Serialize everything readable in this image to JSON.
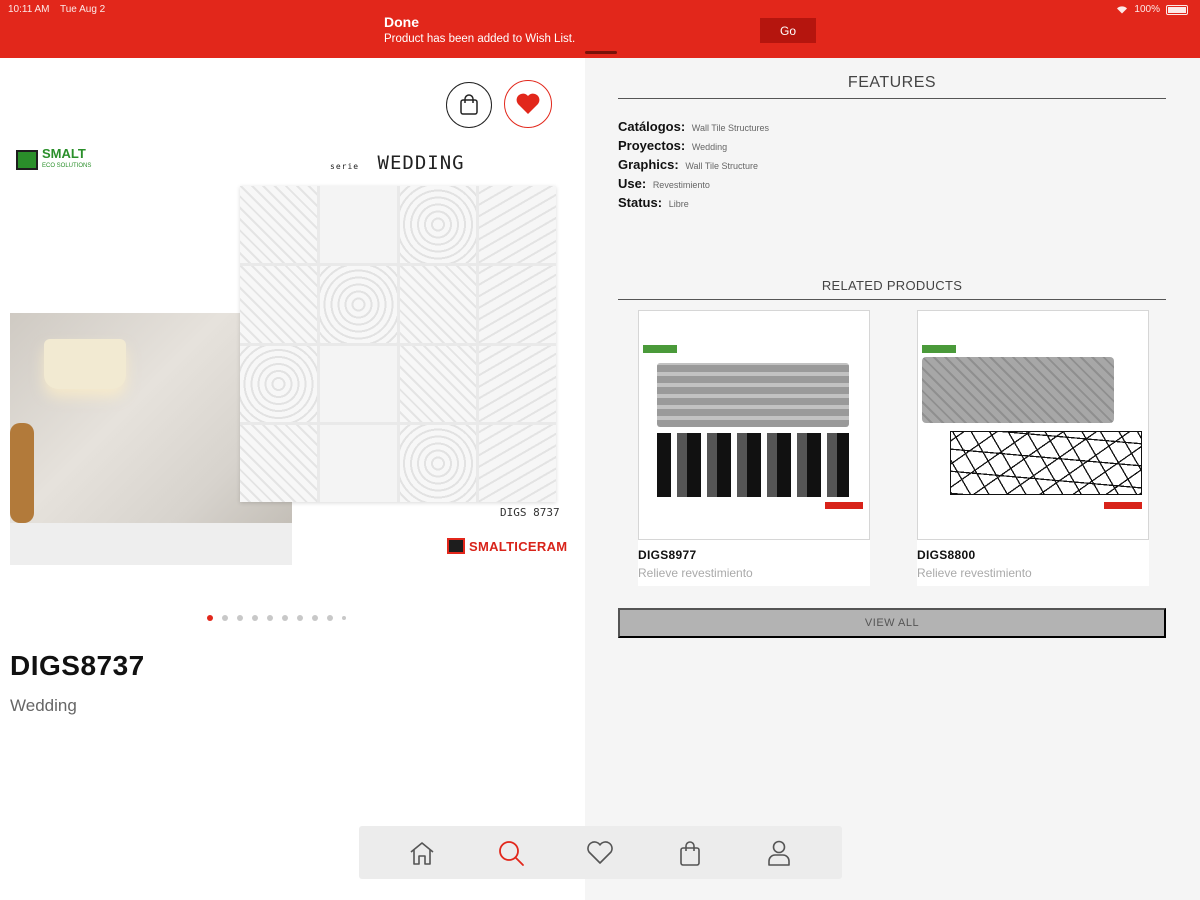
{
  "status_bar": {
    "time": "10:11 AM",
    "date": "Tue Aug 2",
    "battery": "100%"
  },
  "notification": {
    "title": "Done",
    "message": "Product has been added to Wish List.",
    "action_label": "Go"
  },
  "product": {
    "image": {
      "brand_small": "SMALT",
      "brand_small_sub": "ECO SOLUTIONS",
      "serie_prefix": "serie",
      "serie_name": "WEDDING",
      "code_label": "DIGS 8737",
      "brand_logo": "SMALTICERAM"
    },
    "code": "DIGS8737",
    "series": "Wedding",
    "gallery_dots": {
      "total": 10,
      "active_index": 0
    }
  },
  "features": {
    "title": "FEATURES",
    "rows": [
      {
        "key": "Catálogos:",
        "value": "Wall Tile Structures"
      },
      {
        "key": "Proyectos:",
        "value": "Wedding"
      },
      {
        "key": "Graphics:",
        "value": "Wall Tile Structure"
      },
      {
        "key": "Use:",
        "value": "Revestimiento"
      },
      {
        "key": "Status:",
        "value": "Libre"
      }
    ]
  },
  "related": {
    "title": "RELATED PRODUCTS",
    "items": [
      {
        "code": "DIGS8977",
        "description": "Relieve revestimiento"
      },
      {
        "code": "DIGS8800",
        "description": "Relieve revestimiento"
      }
    ],
    "view_all_label": "VIEW ALL"
  },
  "colors": {
    "accent": "#e2271b",
    "banner_button": "#b5150e",
    "view_all_bg": "#b3b3b3",
    "active_nav": "#e2271b"
  },
  "bottom_nav": {
    "items": [
      {
        "icon": "home-icon",
        "active": false
      },
      {
        "icon": "search-icon",
        "active": true
      },
      {
        "icon": "heart-icon",
        "active": false
      },
      {
        "icon": "bag-icon",
        "active": false
      },
      {
        "icon": "user-icon",
        "active": false
      }
    ]
  }
}
